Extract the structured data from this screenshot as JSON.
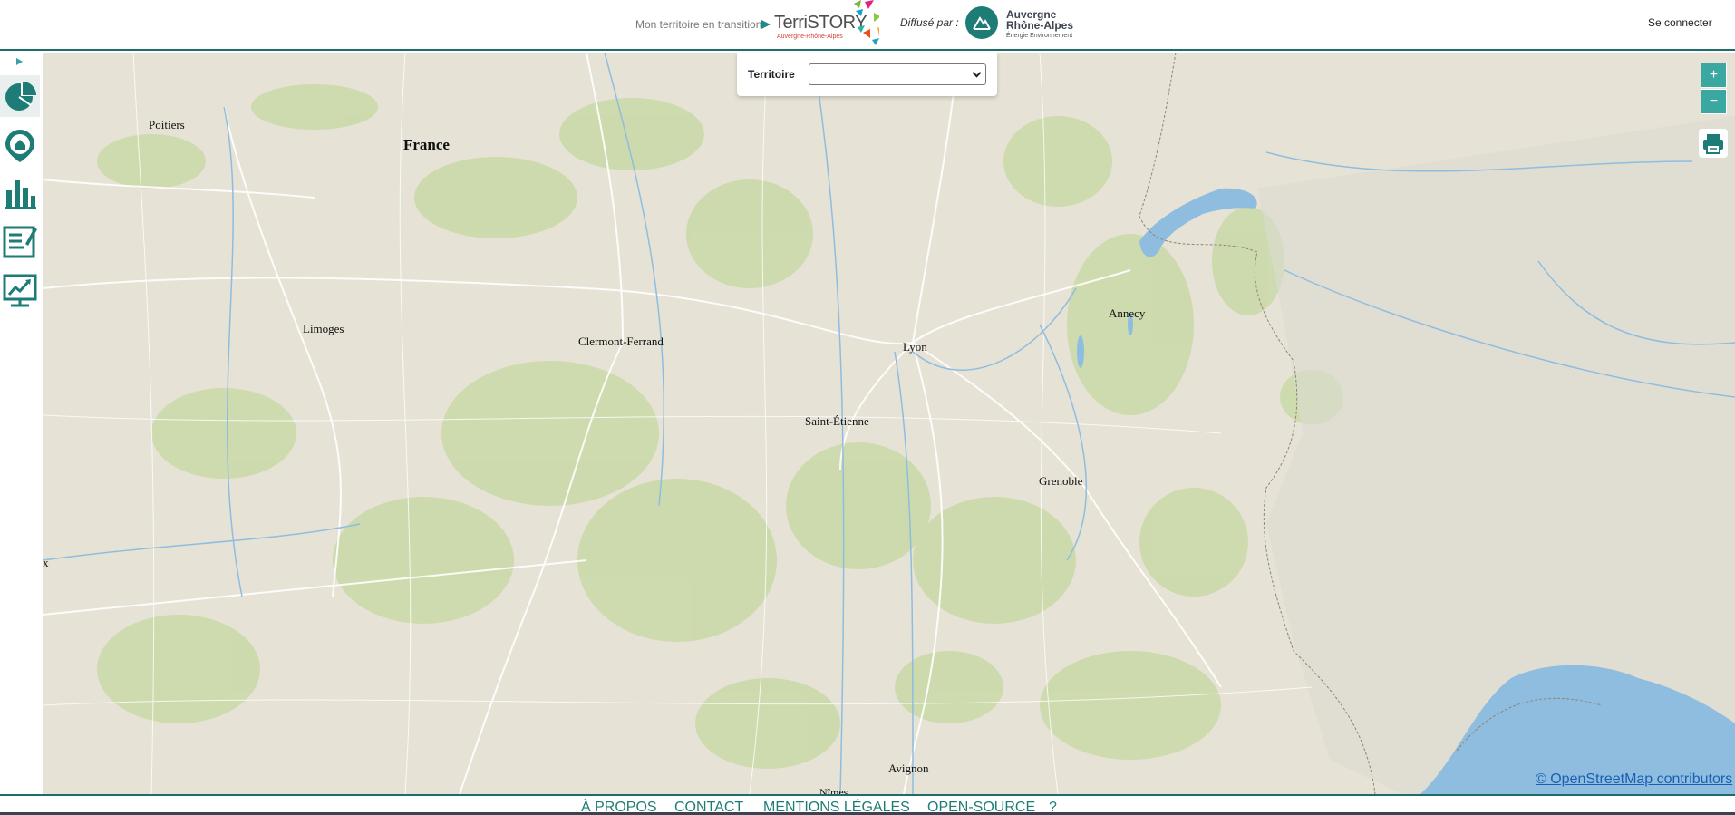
{
  "header": {
    "tagline": "Mon territoire en transition",
    "logo_name": "TerriSTORY",
    "logo_sub": "Auvergne-Rhône-Alpes",
    "distributed_by": "Diffusé par :",
    "partner_line1": "Auvergne",
    "partner_line2": "Rhône-Alpes",
    "partner_line3": "Énergie Environnement",
    "login": "Se connecter"
  },
  "sidebar": {
    "items": [
      {
        "icon": "pie-chart-icon"
      },
      {
        "icon": "home-pin-icon"
      },
      {
        "icon": "bar-chart-icon"
      },
      {
        "icon": "report-icon"
      },
      {
        "icon": "dashboard-icon"
      }
    ]
  },
  "territoire": {
    "label": "Territoire",
    "selected": ""
  },
  "map": {
    "zoom_in": "+",
    "zoom_out": "−",
    "attribution": "© OpenStreetMap contributors",
    "x_mark": "x",
    "cities": [
      {
        "name": "Poitiers"
      },
      {
        "name": "France"
      },
      {
        "name": "Limoges"
      },
      {
        "name": "Clermont-Ferrand"
      },
      {
        "name": "Lyon"
      },
      {
        "name": "Annecy"
      },
      {
        "name": "Saint-Étienne"
      },
      {
        "name": "Grenoble"
      },
      {
        "name": "Avignon"
      },
      {
        "name": "Nîmes"
      }
    ]
  },
  "footer": {
    "links": [
      "À PROPOS",
      "CONTACT",
      "MENTIONS LÉGALES",
      "OPEN-SOURCE",
      "?"
    ]
  },
  "colors": {
    "accent": "#1d7d76",
    "zoom_button": "#3aa8a1",
    "map_land": "#e6e2d5",
    "map_forest": "#c9d9a8",
    "water": "#8fbde0"
  }
}
